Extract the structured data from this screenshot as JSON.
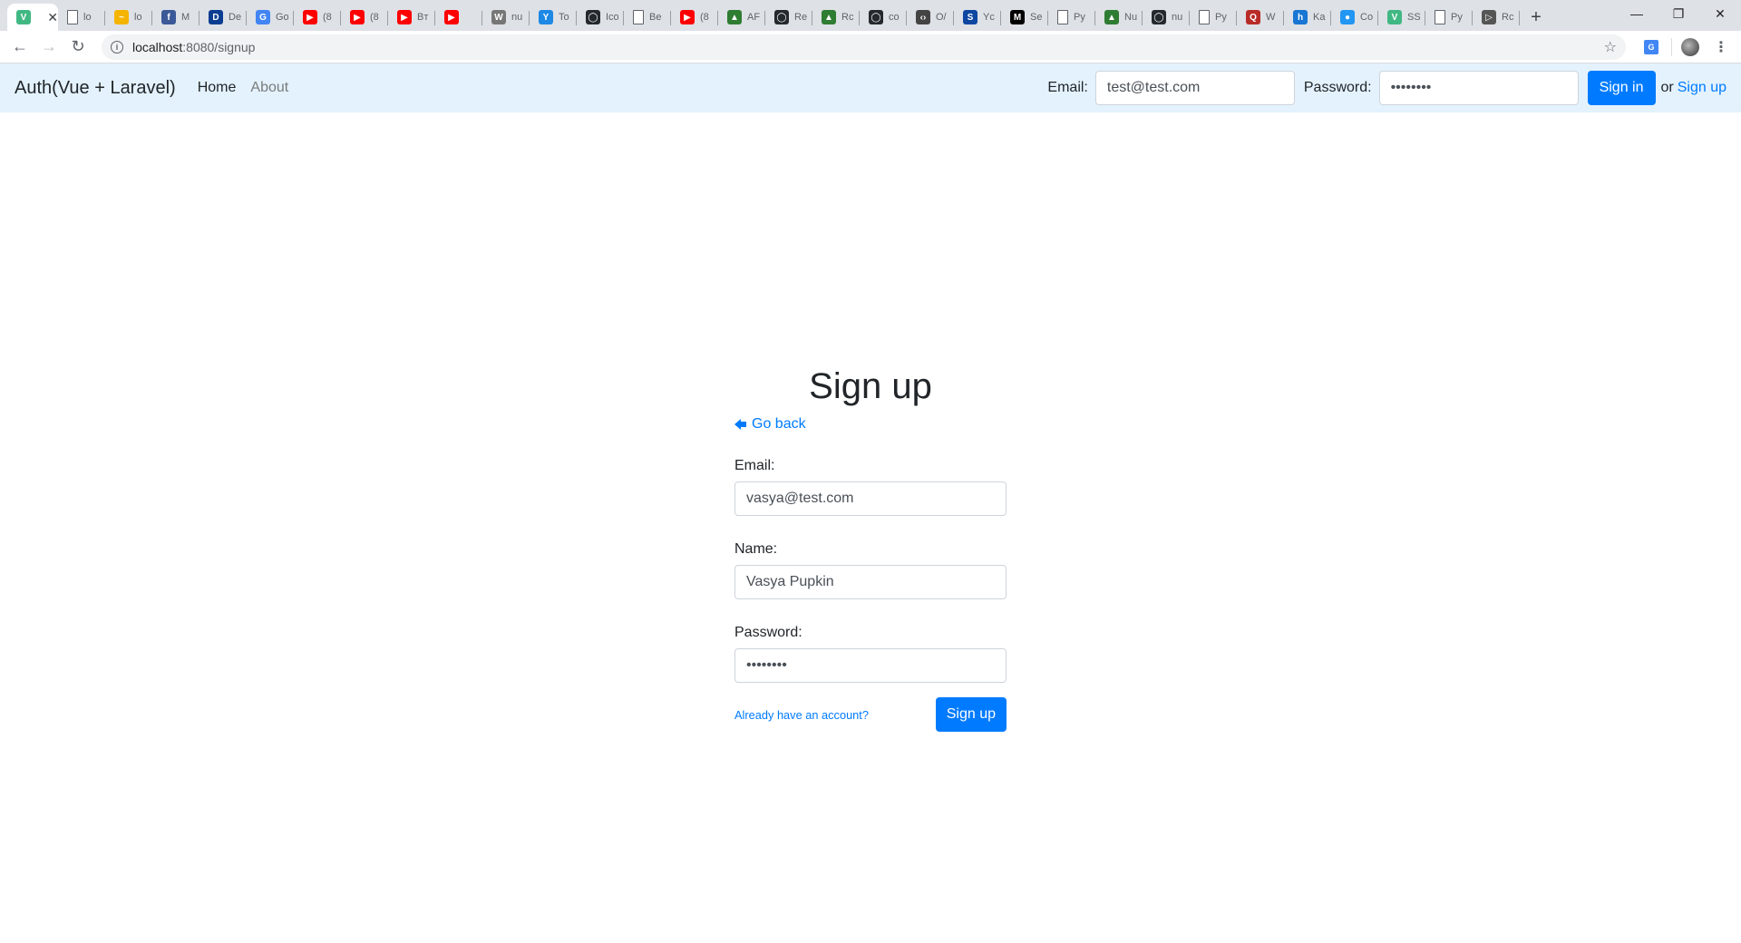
{
  "browser": {
    "tabs": [
      {
        "title": "",
        "favicon": "V",
        "color": "#41b883",
        "active": true
      },
      {
        "title": "lo",
        "favicon": "doc",
        "color": "#ffffff"
      },
      {
        "title": "lo",
        "favicon": "~",
        "color": "#f4b400"
      },
      {
        "title": "M",
        "favicon": "f",
        "color": "#3b5998"
      },
      {
        "title": "De",
        "favicon": "D",
        "color": "#0b3d91"
      },
      {
        "title": "Go",
        "favicon": "G",
        "color": "#4285f4"
      },
      {
        "title": "(8",
        "favicon": "▶",
        "color": "#ff0000"
      },
      {
        "title": "(8",
        "favicon": "▶",
        "color": "#ff0000"
      },
      {
        "title": "Bт",
        "favicon": "▶",
        "color": "#ff0000"
      },
      {
        "title": "",
        "favicon": "▶",
        "color": "#ff0000"
      },
      {
        "title": "nu",
        "favicon": "W",
        "color": "#777777"
      },
      {
        "title": "To",
        "favicon": "Y",
        "color": "#1e88e5"
      },
      {
        "title": "Ico",
        "favicon": "◯",
        "color": "#24292e"
      },
      {
        "title": "Be",
        "favicon": "doc",
        "color": "#ffffff"
      },
      {
        "title": "(8",
        "favicon": "▶",
        "color": "#ff0000"
      },
      {
        "title": "AF",
        "favicon": "▲",
        "color": "#2e7d32"
      },
      {
        "title": "Re",
        "favicon": "◯",
        "color": "#24292e"
      },
      {
        "title": "Rc",
        "favicon": "▲",
        "color": "#2e7d32"
      },
      {
        "title": "co",
        "favicon": "◯",
        "color": "#24292e"
      },
      {
        "title": "O/",
        "favicon": "‹›",
        "color": "#444444"
      },
      {
        "title": "Yc",
        "favicon": "S",
        "color": "#0d47a1"
      },
      {
        "title": "Se",
        "favicon": "M",
        "color": "#000000"
      },
      {
        "title": "Py",
        "favicon": "doc",
        "color": "#ffffff"
      },
      {
        "title": "Nu",
        "favicon": "▲",
        "color": "#2e7d32"
      },
      {
        "title": "nu",
        "favicon": "◯",
        "color": "#24292e"
      },
      {
        "title": "Py",
        "favicon": "doc",
        "color": "#ffffff"
      },
      {
        "title": "W",
        "favicon": "Q",
        "color": "#b92b27"
      },
      {
        "title": "Ka",
        "favicon": "h",
        "color": "#1976d2"
      },
      {
        "title": "Co",
        "favicon": "●",
        "color": "#2196f3"
      },
      {
        "title": "SS",
        "favicon": "V",
        "color": "#41b883"
      },
      {
        "title": "Py",
        "favicon": "doc",
        "color": "#ffffff"
      },
      {
        "title": "Rc",
        "favicon": "▷",
        "color": "#555555"
      }
    ],
    "new_tab": "+",
    "window": {
      "minimize": "—",
      "restore": "❐",
      "close": "✕"
    },
    "url_host": "localhost",
    "url_path": ":8080/signup"
  },
  "navbar": {
    "brand": "Auth(Vue + Laravel)",
    "home": "Home",
    "about": "About",
    "email_label": "Email:",
    "email_value": "test@test.com",
    "password_label": "Password:",
    "password_value": "••••••••",
    "signin_button": "Sign in",
    "or_text": "or",
    "signup_link": "Sign up"
  },
  "form": {
    "title": "Sign up",
    "go_back": "Go back",
    "email_label": "Email:",
    "email_value": "vasya@test.com",
    "name_label": "Name:",
    "name_value": "Vasya Pupkin",
    "password_label": "Password:",
    "password_value": "••••••••",
    "already_link": "Already have an account?",
    "submit": "Sign up"
  },
  "colors": {
    "navbar_bg": "#e3f2fd",
    "primary": "#007bff"
  }
}
